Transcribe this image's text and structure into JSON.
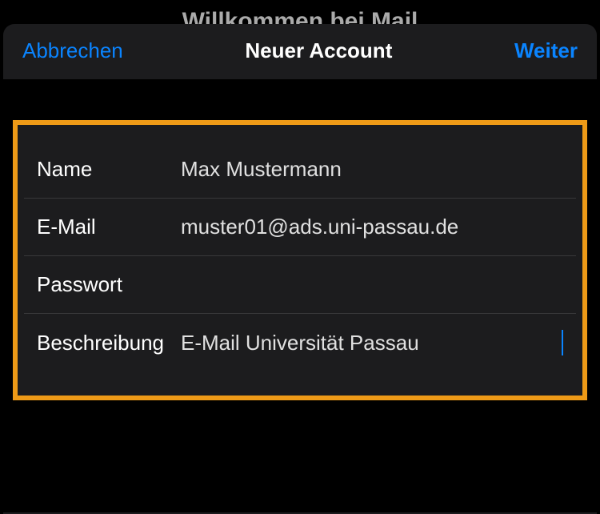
{
  "background": {
    "title": "Willkommen bei Mail"
  },
  "nav": {
    "cancel": "Abbrechen",
    "title": "Neuer Account",
    "next": "Weiter"
  },
  "form": {
    "name": {
      "label": "Name",
      "value": "Max Mustermann"
    },
    "email": {
      "label": "E-Mail",
      "value": "muster01@ads.uni-passau.de"
    },
    "password": {
      "label": "Passwort",
      "value": ""
    },
    "description": {
      "label": "Beschreibung",
      "value": "E-Mail Universität Passau"
    }
  },
  "colors": {
    "accent": "#0a84ff",
    "highlight_border": "#ee9a17"
  }
}
